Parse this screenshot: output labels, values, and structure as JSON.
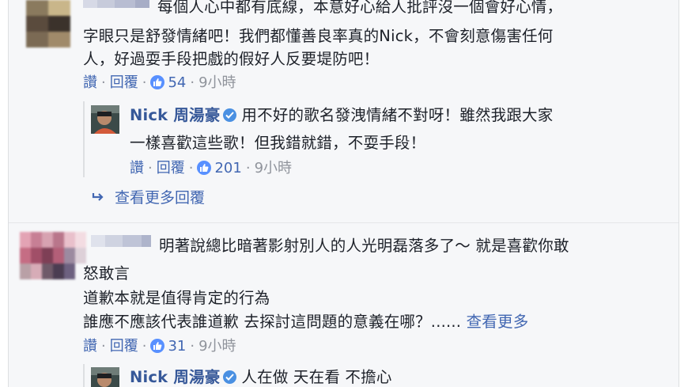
{
  "comment1": {
    "text_line1": "每個人心中都有底線，本意好心給人批評沒一個會好心情，",
    "text_line2": "字眼只是舒發情緒吧！我們都懂善良率真的Nick，不會刻意傷害任何",
    "text_line3": "人，好過耍手段把戲的假好人反要堤防吧！",
    "like_label": "讚",
    "reply_label": "回覆",
    "like_count": "54",
    "time": "9小時"
  },
  "reply1": {
    "author": "Nick 周湯豪",
    "text_line1": "用不好的歌名發洩情緒不對呀！雖然我跟大家",
    "text_line2": "一樣喜歡這些歌！但我錯就錯，不耍手段！",
    "like_label": "讚",
    "reply_label": "回覆",
    "like_count": "201",
    "time": "9小時"
  },
  "more_replies": {
    "label": "查看更多回覆"
  },
  "comment2": {
    "text_line1": "明著說總比暗著影射別人的人光明磊落多了～ 就是喜歡你敢",
    "text_line2": "怒敢言",
    "text_line3": "道歉本就是值得肯定的行為",
    "text_line4": "誰應不應該代表誰道歉 去探討這問題的意義在哪？......",
    "see_more": "查看更多",
    "like_label": "讚",
    "reply_label": "回覆",
    "like_count": "31",
    "time": "9小時"
  },
  "reply2": {
    "author": "Nick 周湯豪",
    "text": "人在做 天在看 不擔心"
  },
  "colors": {
    "link": "#4267b2",
    "author": "#365899",
    "meta": "#90949c",
    "like_badge": "#5890ff"
  },
  "icons": [
    "like-icon",
    "verified-icon",
    "reply-arrow-icon"
  ]
}
